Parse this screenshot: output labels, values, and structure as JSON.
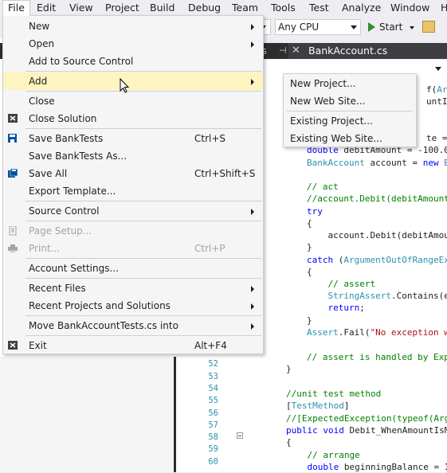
{
  "menubar": {
    "items": [
      "File",
      "Edit",
      "View",
      "Project",
      "Build",
      "Debug",
      "Team",
      "Tools",
      "Test",
      "Analyze",
      "Window",
      "H"
    ]
  },
  "toolbar": {
    "platform": "Any CPU",
    "start_label": "Start"
  },
  "tabs": {
    "tab1": "cs",
    "tab2": "BankAccount.cs"
  },
  "file_menu": {
    "items": [
      {
        "label": "New",
        "shortcut": "",
        "submenu": true
      },
      {
        "label": "Open",
        "shortcut": "",
        "submenu": true
      },
      {
        "label": "Add to Source Control",
        "shortcut": "",
        "submenu": false
      },
      {
        "label": "Add",
        "shortcut": "",
        "submenu": true
      },
      {
        "label": "Close",
        "shortcut": "",
        "submenu": false
      },
      {
        "label": "Close Solution",
        "shortcut": "",
        "submenu": false
      },
      {
        "label": "Save BankTests",
        "shortcut": "Ctrl+S",
        "submenu": false
      },
      {
        "label": "Save BankTests As...",
        "shortcut": "",
        "submenu": false
      },
      {
        "label": "Save All",
        "shortcut": "Ctrl+Shift+S",
        "submenu": false
      },
      {
        "label": "Export Template...",
        "shortcut": "",
        "submenu": false
      },
      {
        "label": "Source Control",
        "shortcut": "",
        "submenu": true
      },
      {
        "label": "Page Setup...",
        "shortcut": "",
        "submenu": false
      },
      {
        "label": "Print...",
        "shortcut": "Ctrl+P",
        "submenu": false
      },
      {
        "label": "Account Settings...",
        "shortcut": "",
        "submenu": false
      },
      {
        "label": "Recent Files",
        "shortcut": "",
        "submenu": true
      },
      {
        "label": "Recent Projects and Solutions",
        "shortcut": "",
        "submenu": true
      },
      {
        "label": "Move BankAccountTests.cs into",
        "shortcut": "",
        "submenu": true
      },
      {
        "label": "Exit",
        "shortcut": "Alt+F4",
        "submenu": false
      }
    ]
  },
  "add_submenu": {
    "items": [
      "New Project...",
      "New Web Site...",
      "Existing Project...",
      "Existing Web Site..."
    ]
  },
  "editor": {
    "line_numbers": [
      "51",
      "52",
      "53",
      "54",
      "55",
      "56",
      "57",
      "58",
      "59",
      "60"
    ],
    "code": [
      {
        "parts": [
          {
            "c": "pl",
            "t": "f("
          },
          {
            "c": "ty",
            "t": "Argu"
          }
        ]
      },
      {
        "parts": [
          {
            "c": "pl",
            "t": "untIsLe"
          }
        ]
      },
      {
        "parts": [
          {
            "c": "pl",
            "t": "te = 11"
          }
        ]
      },
      {
        "parts": [
          {
            "c": "kw",
            "t": "double"
          },
          {
            "c": "pl",
            "t": " debitAmount = -100.00"
          }
        ]
      },
      {
        "parts": [
          {
            "c": "ty",
            "t": "BankAccount"
          },
          {
            "c": "pl",
            "t": " account = "
          },
          {
            "c": "kw",
            "t": "new"
          },
          {
            "c": "ty",
            "t": " Ba"
          }
        ]
      },
      {
        "parts": [
          {
            "c": "cm",
            "t": "// act"
          }
        ]
      },
      {
        "parts": [
          {
            "c": "cm",
            "t": "//account.Debit(debitAmount)"
          }
        ]
      },
      {
        "parts": [
          {
            "c": "kw",
            "t": "try"
          }
        ]
      },
      {
        "parts": [
          {
            "c": "pl",
            "t": "{"
          }
        ]
      },
      {
        "parts": [
          {
            "c": "pl",
            "t": "    account.Debit(debitAmour"
          }
        ]
      },
      {
        "parts": [
          {
            "c": "pl",
            "t": "}"
          }
        ]
      },
      {
        "parts": [
          {
            "c": "kw",
            "t": "catch"
          },
          {
            "c": "pl",
            "t": " ("
          },
          {
            "c": "ty",
            "t": "ArgumentOutOfRangeExce"
          }
        ]
      },
      {
        "parts": [
          {
            "c": "pl",
            "t": "{"
          }
        ]
      },
      {
        "parts": [
          {
            "c": "cm",
            "t": "    // assert"
          }
        ]
      },
      {
        "parts": [
          {
            "c": "ty",
            "t": "    StringAssert"
          },
          {
            "c": "pl",
            "t": ".Contains(e"
          }
        ]
      },
      {
        "parts": [
          {
            "c": "kw",
            "t": "    return"
          },
          {
            "c": "pl",
            "t": ";"
          }
        ]
      },
      {
        "parts": [
          {
            "c": "pl",
            "t": "}"
          }
        ]
      },
      {
        "parts": [
          {
            "c": "ty",
            "t": "Assert"
          },
          {
            "c": "pl",
            "t": ".Fail("
          },
          {
            "c": "st",
            "t": "\"No exception wa"
          }
        ]
      },
      {
        "parts": [
          {
            "c": "cm",
            "t": "// assert is handled by Expe"
          }
        ]
      },
      {
        "parts": [
          {
            "c": "pl",
            "t": "}"
          }
        ]
      },
      {
        "parts": [
          {
            "c": "cm",
            "t": "//unit test method"
          }
        ]
      },
      {
        "parts": [
          {
            "c": "pl",
            "t": "["
          },
          {
            "c": "ty",
            "t": "TestMethod"
          },
          {
            "c": "pl",
            "t": "]"
          }
        ]
      },
      {
        "parts": [
          {
            "c": "cm",
            "t": "//[ExpectedException(typeof(Argu"
          }
        ]
      },
      {
        "parts": [
          {
            "c": "kw",
            "t": "public void"
          },
          {
            "c": "pl",
            "t": " Debit_WhenAmountIsMo"
          }
        ]
      },
      {
        "parts": [
          {
            "c": "pl",
            "t": "{"
          }
        ]
      },
      {
        "parts": [
          {
            "c": "cm",
            "t": "    // arrange"
          }
        ]
      },
      {
        "parts": [
          {
            "c": "kw",
            "t": "    double"
          },
          {
            "c": "pl",
            "t": " beginningBalance = 1"
          }
        ]
      }
    ]
  },
  "colors": {
    "menu_bg": "#f5f5f5",
    "highlight": "#fdf4bf",
    "keyword": "#0000ff",
    "type": "#2b91af",
    "comment": "#008000",
    "string": "#a31515"
  },
  "icons": {
    "close": "close-icon",
    "save": "save-icon",
    "save_all": "save-all-icon",
    "page_setup": "page-setup-icon",
    "print": "print-icon",
    "exit": "exit-icon",
    "start": "play-icon"
  }
}
